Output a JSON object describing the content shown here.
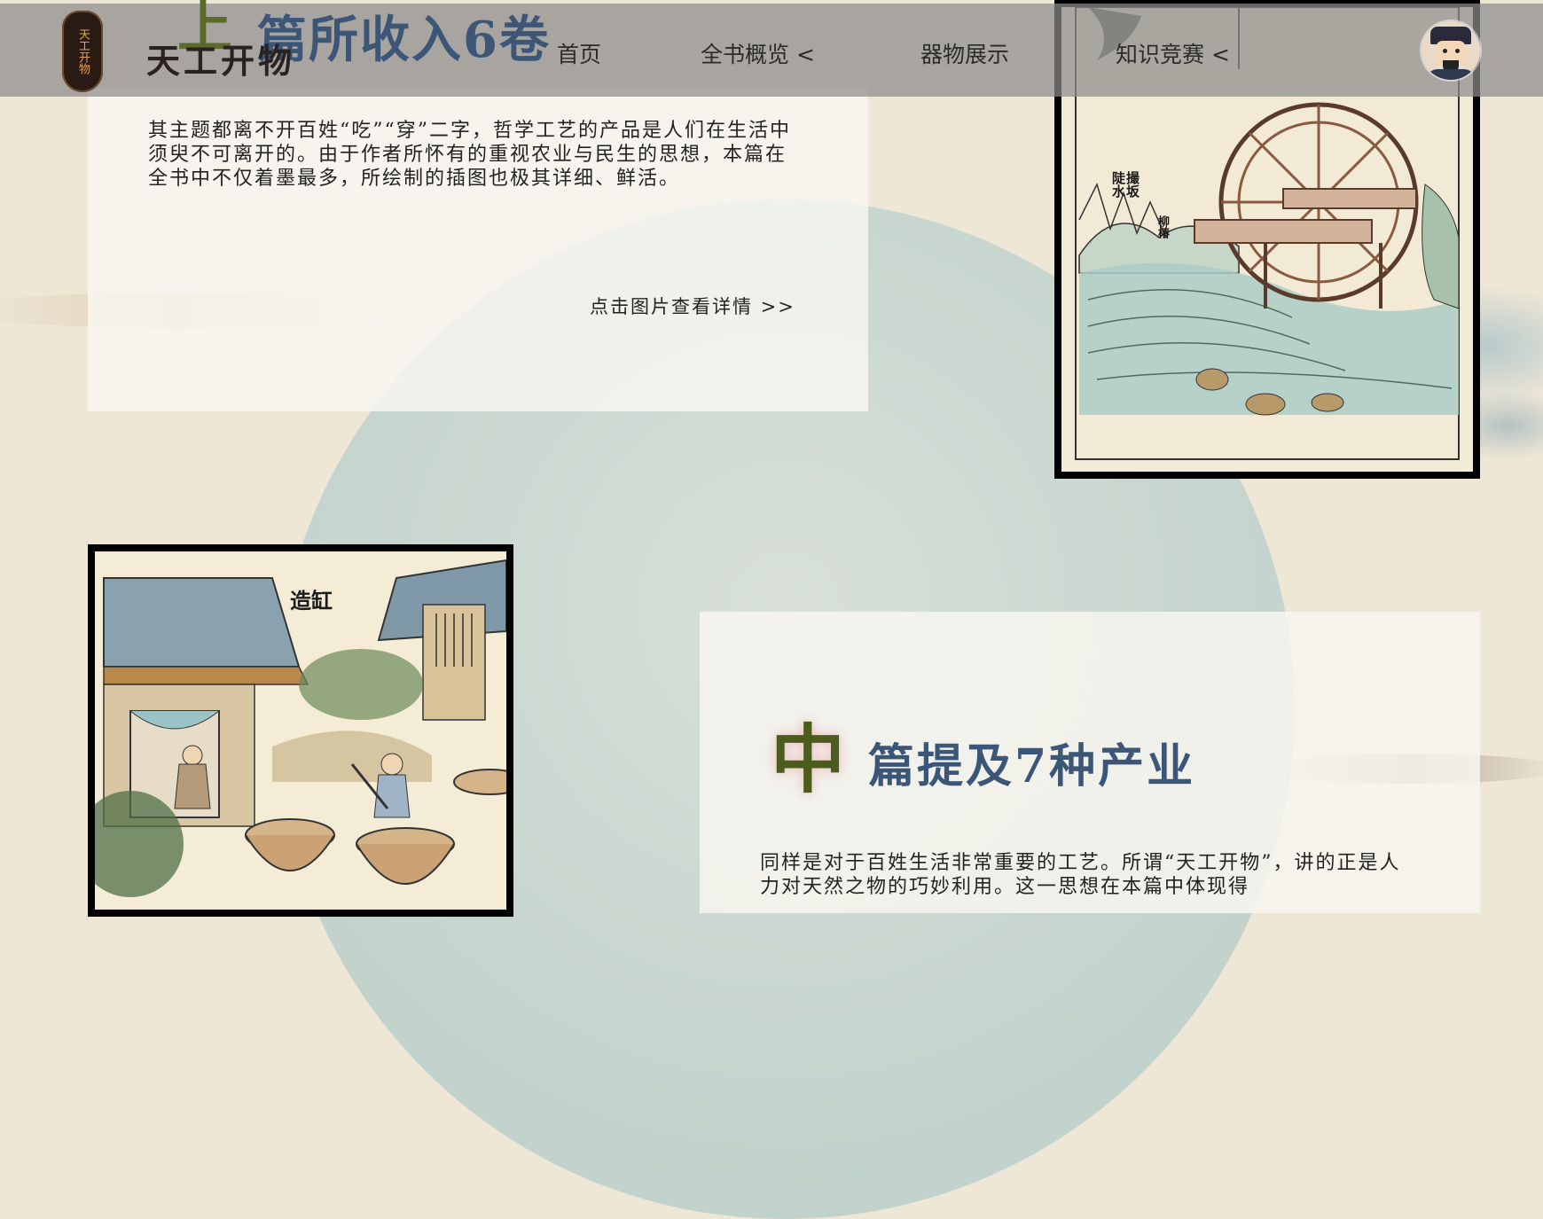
{
  "header": {
    "logo_text": "天工开物",
    "brand_text": "天工开物",
    "nav": [
      {
        "label": "首页"
      },
      {
        "label": "全书概览 <"
      },
      {
        "label": "器物展示"
      },
      {
        "label": "知识竞赛 <"
      }
    ]
  },
  "section_top": {
    "char": "上",
    "title": "篇所收入6卷",
    "body": "其主题都离不开百姓“吃”“穿”二字，哲学工艺的产品是人们在生活中须臾不可离开的。由于作者所怀有的重视农业与民生的思想，本篇在全书中不仅着墨最多，所绘制的插图也极其详细、鲜活。",
    "link": "点击图片查看详情 >>"
  },
  "illustrations": {
    "water_wheel_labels": [
      "撮坂",
      "陡水",
      "柳椿"
    ],
    "vat_caption": "造缸"
  },
  "section_mid": {
    "char": "中",
    "title": "篇提及7种产业",
    "body": "同样是对于百姓生活非常重要的工艺。所谓“天工开物”，讲的正是人力对天然之物的巧妙利用。这一思想在本篇中体现得"
  },
  "colors": {
    "title_blue": "#3c5677",
    "char_green": "#4b5d1c",
    "header_gray": "#8c8c8c",
    "background": "#efe7d6",
    "teal_circle": "#bfd2cd"
  }
}
